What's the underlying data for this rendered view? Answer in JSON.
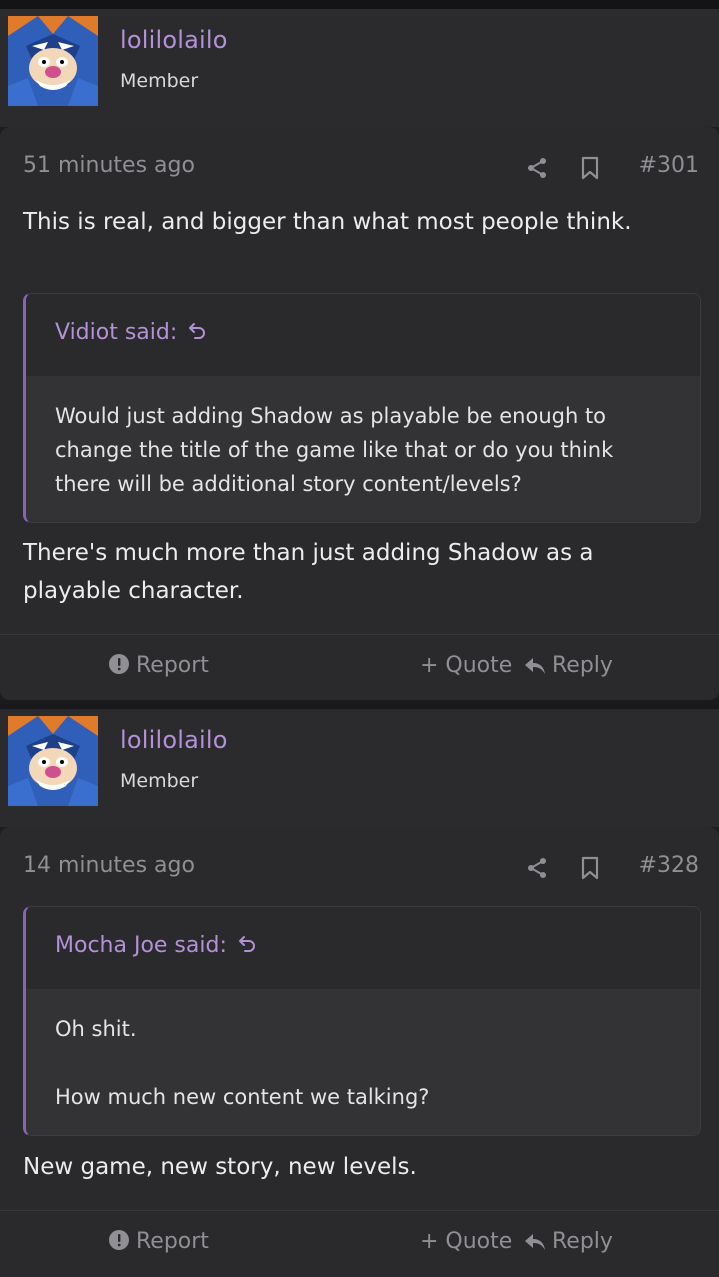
{
  "posts": [
    {
      "username": "lolilolailo",
      "user_title": "Member",
      "time": "51 minutes ago",
      "post_number": "#301",
      "message_before": "This is real, and bigger than what most people think.",
      "quote": {
        "author": "Vidiot said:",
        "lines": [
          "Would just adding Shadow as playable be enough to change the title of the game like that or do you think there will be additional story content/levels?"
        ]
      },
      "message_after": "There's much more than just adding Shadow as a playable character.",
      "actions": {
        "report": "Report",
        "quote": "+ Quote",
        "reply": "Reply"
      }
    },
    {
      "username": "lolilolailo",
      "user_title": "Member",
      "time": "14 minutes ago",
      "post_number": "#328",
      "quote": {
        "author": "Mocha Joe said:",
        "lines": [
          "Oh shit.",
          "How much new content we talking?"
        ]
      },
      "message_after": "New game, new story, new levels.",
      "actions": {
        "report": "Report",
        "quote": "+ Quote",
        "reply": "Reply"
      }
    }
  ],
  "colors": {
    "accent": "#b391d6",
    "quote_bar": "#8a63b8",
    "muted": "#8f8f94",
    "panel": "#2a2a2d",
    "header": "#2b2b2e"
  },
  "icons": [
    "share-icon",
    "bookmark-icon",
    "reply-arrow-icon",
    "report-icon",
    "reply-icon"
  ]
}
